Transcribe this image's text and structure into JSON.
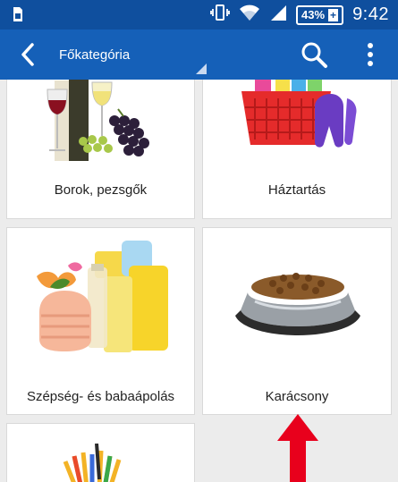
{
  "status_bar": {
    "battery_level": "43%",
    "battery_charging_symbol": "+",
    "time": "9:42",
    "icons": [
      "sim-icon",
      "vibrate-icon",
      "wifi-icon",
      "signal-icon",
      "battery-icon"
    ]
  },
  "app_bar": {
    "title": "Főkategória",
    "icons": [
      "back-arrow-icon",
      "search-icon",
      "overflow-menu-icon"
    ]
  },
  "categories": [
    {
      "label": "Borok, pezsgők",
      "icon": "wine-image"
    },
    {
      "label": "Háztartás",
      "icon": "cleaning-basket-image"
    },
    {
      "label": "Szépség- és babaápolás",
      "icon": "beauty-products-image"
    },
    {
      "label": "Karácsony",
      "icon": "pet-food-bowl-image"
    },
    {
      "label": "",
      "icon": "pencils-image"
    }
  ],
  "colors": {
    "status_bar": "#0f4f9e",
    "app_bar": "#1560b8",
    "background": "#ececec",
    "arrow": "#e8001c"
  }
}
